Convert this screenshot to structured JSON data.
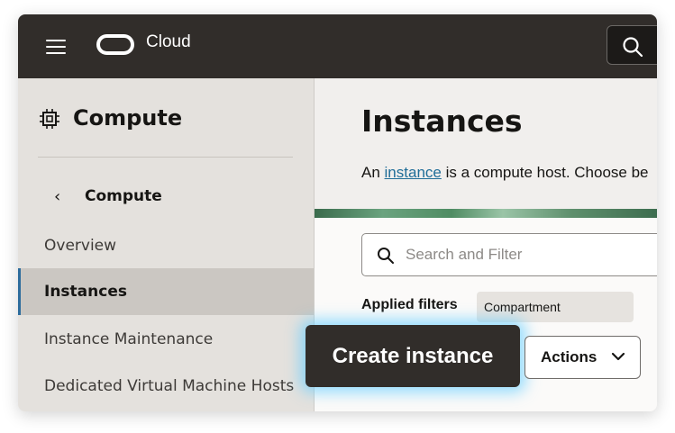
{
  "header": {
    "brand": "Cloud"
  },
  "sidebar": {
    "title": "Compute",
    "back_label": "Compute",
    "items": [
      {
        "label": "Overview"
      },
      {
        "label": "Instances"
      },
      {
        "label": "Instance Maintenance"
      },
      {
        "label": "Dedicated Virtual Machine Hosts"
      }
    ]
  },
  "main": {
    "title": "Instances",
    "intro_prefix": "An ",
    "intro_link": "instance",
    "intro_suffix": " is a compute host. Choose be",
    "search_placeholder": "Search and Filter",
    "applied_filters_label": "Applied filters",
    "filter_chip": "Compartment",
    "create_button": "Create instance",
    "actions_button": "Actions"
  },
  "colors": {
    "topbar": "#312d2a",
    "sidebar": "#e4e1dd",
    "accent_link": "#1f6d98",
    "highlight_glow": "#66ceff"
  }
}
